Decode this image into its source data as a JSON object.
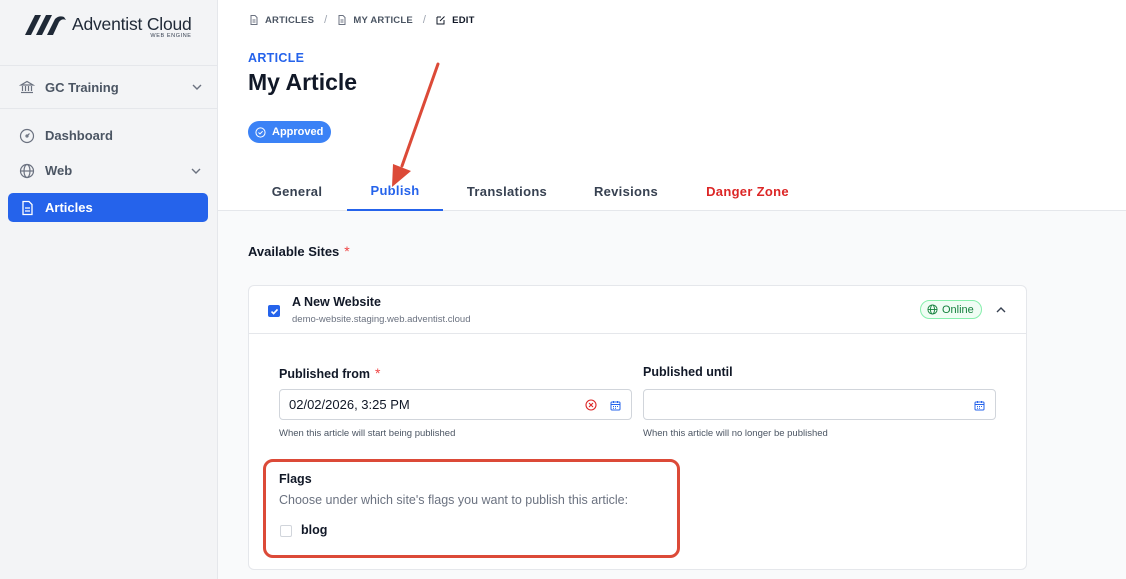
{
  "app": {
    "brand": "Adventist Cloud",
    "brand_sub": "WEB ENGINE"
  },
  "sidebar": {
    "org": {
      "label": "GC Training",
      "icon": "bank-icon"
    },
    "items": [
      {
        "label": "Dashboard",
        "icon": "dashboard-icon"
      },
      {
        "label": "Web",
        "icon": "globe-icon"
      },
      {
        "label": "Articles",
        "icon": "article-icon",
        "active": true
      }
    ]
  },
  "breadcrumb": [
    {
      "label": "ARTICLES",
      "icon": "file-icon"
    },
    {
      "label": "MY ARTICLE",
      "icon": "file-icon"
    },
    {
      "label": "EDIT",
      "icon": "edit-icon"
    }
  ],
  "header": {
    "kicker": "ARTICLE",
    "title": "My Article",
    "status": "Approved"
  },
  "tabs": [
    {
      "label": "General"
    },
    {
      "label": "Publish",
      "active": true
    },
    {
      "label": "Translations"
    },
    {
      "label": "Revisions"
    },
    {
      "label": "Danger Zone"
    }
  ],
  "publish": {
    "available_sites_label": "Available Sites",
    "required_mark": "*",
    "site": {
      "name": "A New Website",
      "url": "demo-website.staging.web.adventist.cloud",
      "status": "Online",
      "checked": true
    },
    "published_from": {
      "label": "Published from",
      "value": "02/02/2026, 3:25 PM",
      "hint": "When this article will start being published"
    },
    "published_until": {
      "label": "Published until",
      "value": "",
      "hint": "When this article will no longer be published"
    },
    "flags": {
      "title": "Flags",
      "description": "Choose under which site's flags you want to publish this article:",
      "options": [
        {
          "label": "blog",
          "checked": false
        }
      ]
    }
  },
  "colors": {
    "accent": "#2563eb",
    "danger": "#dc2626",
    "annotation": "#dc4a38",
    "online": "#15803d"
  }
}
